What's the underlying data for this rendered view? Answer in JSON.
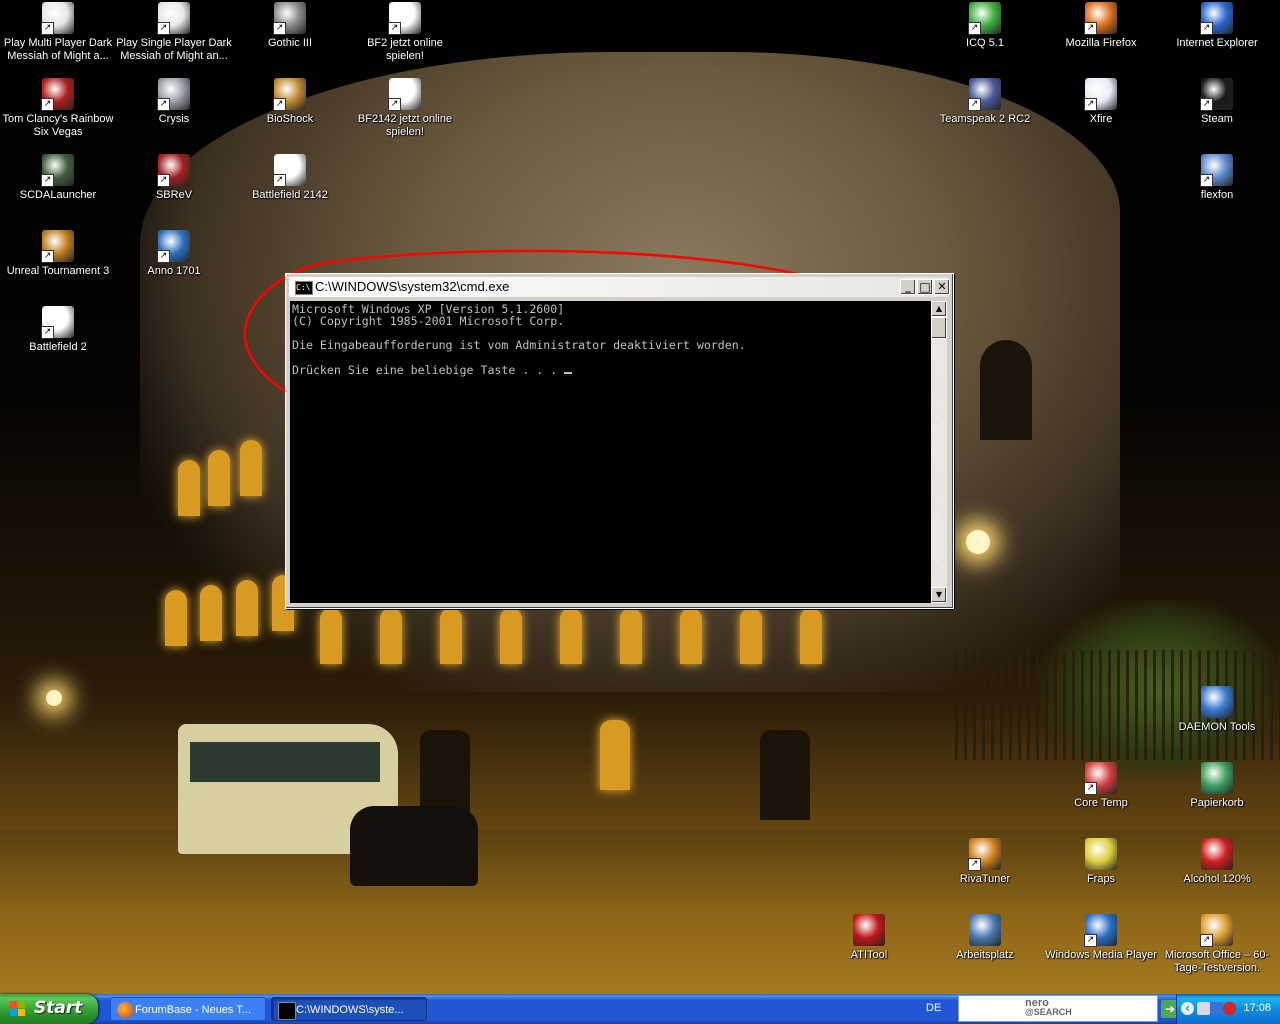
{
  "desktop": {
    "icons_left": [
      {
        "label": "Play Multi Player Dark Messiah of Might a...",
        "icon": "dark-messiah-icon",
        "color": "#e8e8e8"
      },
      {
        "label": "Play Single Player Dark Messiah of Might an...",
        "icon": "dark-messiah-icon",
        "color": "#e8e8e8"
      },
      {
        "label": "Gothic III",
        "icon": "gothic-icon",
        "color": "#8a8a8a"
      },
      {
        "label": "BF2 jetzt online spielen!",
        "icon": "battlefield-icon",
        "color": "#ffffff"
      },
      {
        "label": "Tom Clancy's Rainbow Six Vegas",
        "icon": "rainbow-six-icon",
        "color": "#b02020"
      },
      {
        "label": "Crysis",
        "icon": "crysis-icon",
        "color": "#9aa0a8"
      },
      {
        "label": "BioShock",
        "icon": "bioshock-icon",
        "color": "#c08a30"
      },
      {
        "label": "BF2142 jetzt online spielen!",
        "icon": "battlefield-icon",
        "color": "#ffffff"
      },
      {
        "label": "SCDALauncher",
        "icon": "splinter-cell-icon",
        "color": "#406040"
      },
      {
        "label": "SBReV",
        "icon": "sbrev-icon",
        "color": "#a02020"
      },
      {
        "label": "Battlefield 2142",
        "icon": "battlefield-icon",
        "color": "#ffffff"
      },
      {
        "label": "Unreal Tournament 3",
        "icon": "unreal-icon",
        "color": "#c08020"
      },
      {
        "label": "Anno 1701",
        "icon": "anno-icon",
        "color": "#3070c0"
      },
      {
        "label": "Battlefield 2",
        "icon": "battlefield-icon",
        "color": "#ffffff"
      }
    ],
    "icons_right_top": [
      {
        "label": "ICQ 5.1",
        "icon": "icq-flower-icon",
        "color": "#40b040"
      },
      {
        "label": "Mozilla Firefox",
        "icon": "firefox-icon",
        "color": "#e07020"
      },
      {
        "label": "Internet Explorer",
        "icon": "internet-explorer-icon",
        "color": "#2a6ad0"
      },
      {
        "label": "Teamspeak 2 RC2",
        "icon": "teamspeak-icon",
        "color": "#4a5a9a"
      },
      {
        "label": "Xfire",
        "icon": "xfire-icon",
        "color": "#e8eef8"
      },
      {
        "label": "Steam",
        "icon": "steam-icon",
        "color": "#1a1a1a"
      },
      {
        "label": "flexfon",
        "icon": "flexfon-icon",
        "color": "#5a8ad0"
      }
    ],
    "icons_right_bottom": [
      {
        "label": "DAEMON Tools",
        "icon": "daemon-tools-icon",
        "color": "#3a7ad0"
      },
      {
        "label": "Core Temp",
        "icon": "thermometer-icon",
        "color": "#d04040"
      },
      {
        "label": "Papierkorb",
        "icon": "recycle-bin-icon",
        "color": "#40a060"
      },
      {
        "label": "RivaTuner",
        "icon": "rivatuner-icon",
        "color": "#d08020"
      },
      {
        "label": "Fraps",
        "icon": "fraps-icon",
        "color": "#e0d040"
      },
      {
        "label": "Alcohol 120%",
        "icon": "alcohol-icon",
        "color": "#d02020"
      },
      {
        "label": "ATITool",
        "icon": "atitool-icon",
        "color": "#c01818"
      },
      {
        "label": "Arbeitsplatz",
        "icon": "my-computer-icon",
        "color": "#4a7ab0"
      },
      {
        "label": "Windows Media Player",
        "icon": "media-player-icon",
        "color": "#2a70c8"
      },
      {
        "label": "Microsoft Office – 60-Tage-Testversion.",
        "icon": "office-icon",
        "color": "#e0a030"
      }
    ]
  },
  "cmd_window": {
    "title": "C:\\WINDOWS\\system32\\cmd.exe",
    "app_icon_text": "C:\\",
    "minimize": "_",
    "maximize": "□",
    "close": "✕",
    "lines": [
      "Microsoft Windows XP [Version 5.1.2600]",
      "(C) Copyright 1985-2001 Microsoft Corp.",
      "",
      "Die Eingabeaufforderung ist vom Administrator deaktiviert worden.",
      "",
      "Drücken Sie eine beliebige Taste . . . "
    ],
    "scroll_up": "▲",
    "scroll_down": "▼"
  },
  "taskbar": {
    "start_label": "Start",
    "buttons": [
      {
        "label": "ForumBase - Neues T...",
        "icon": "firefox-icon",
        "active": false
      },
      {
        "label": "C:\\WINDOWS\\syste...",
        "icon": "cmd-icon",
        "active": true
      }
    ],
    "language": "DE",
    "nero_search": "nero",
    "nero_search_sub": "@SEARCH",
    "nero_go": "➔",
    "tray_expand": "‹",
    "clock": "17:08"
  },
  "colors": {
    "annotation": "#ff0000",
    "taskbar_blue": "#2157d7",
    "start_green": "#2f9a2f"
  }
}
